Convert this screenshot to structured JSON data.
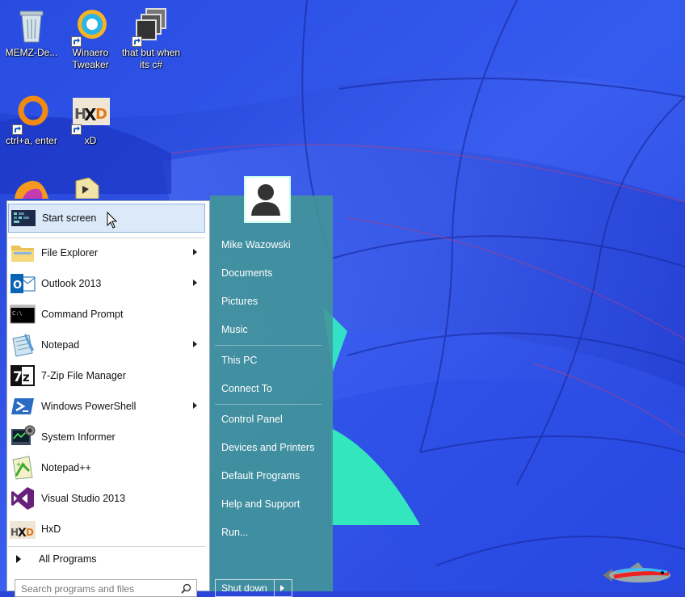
{
  "desktop": {
    "icons": [
      {
        "label": "MEMZ-De..."
      },
      {
        "label": "Winaero Tweaker"
      },
      {
        "label": "that but when its c#"
      },
      {
        "label": "ctrl+a, enter"
      },
      {
        "label": "xD"
      }
    ]
  },
  "start_menu": {
    "pinned": [
      {
        "label": "Start screen",
        "icon": "start-screen-icon"
      },
      {
        "label": "File Explorer",
        "icon": "folder-icon",
        "submenu": true
      },
      {
        "label": "Outlook 2013",
        "icon": "outlook-icon",
        "submenu": true
      },
      {
        "label": "Command Prompt",
        "icon": "command-prompt-icon"
      },
      {
        "label": "Notepad",
        "icon": "notepad-icon",
        "submenu": true
      },
      {
        "label": "7-Zip File Manager",
        "icon": "7zip-icon"
      },
      {
        "label": "Windows PowerShell",
        "icon": "powershell-icon",
        "submenu": true
      },
      {
        "label": "System Informer",
        "icon": "system-informer-icon"
      },
      {
        "label": "Notepad++",
        "icon": "notepadplusplus-icon"
      },
      {
        "label": "Visual Studio 2013",
        "icon": "visual-studio-icon"
      },
      {
        "label": "HxD",
        "icon": "hxd-icon"
      }
    ],
    "all_programs": "All Programs",
    "search_placeholder": "Search programs and files",
    "right_links": [
      "Mike Wazowski",
      "Documents",
      "Pictures",
      "Music",
      "This PC",
      "Connect To",
      "Control Panel",
      "Devices and Printers",
      "Default Programs",
      "Help and Support",
      "Run..."
    ],
    "shutdown_label": "Shut down"
  },
  "colors": {
    "wallpaper_blue": "#2a45d8",
    "menu_teal": "#4a9a9a",
    "hover_blue": "#dbe9f8"
  }
}
